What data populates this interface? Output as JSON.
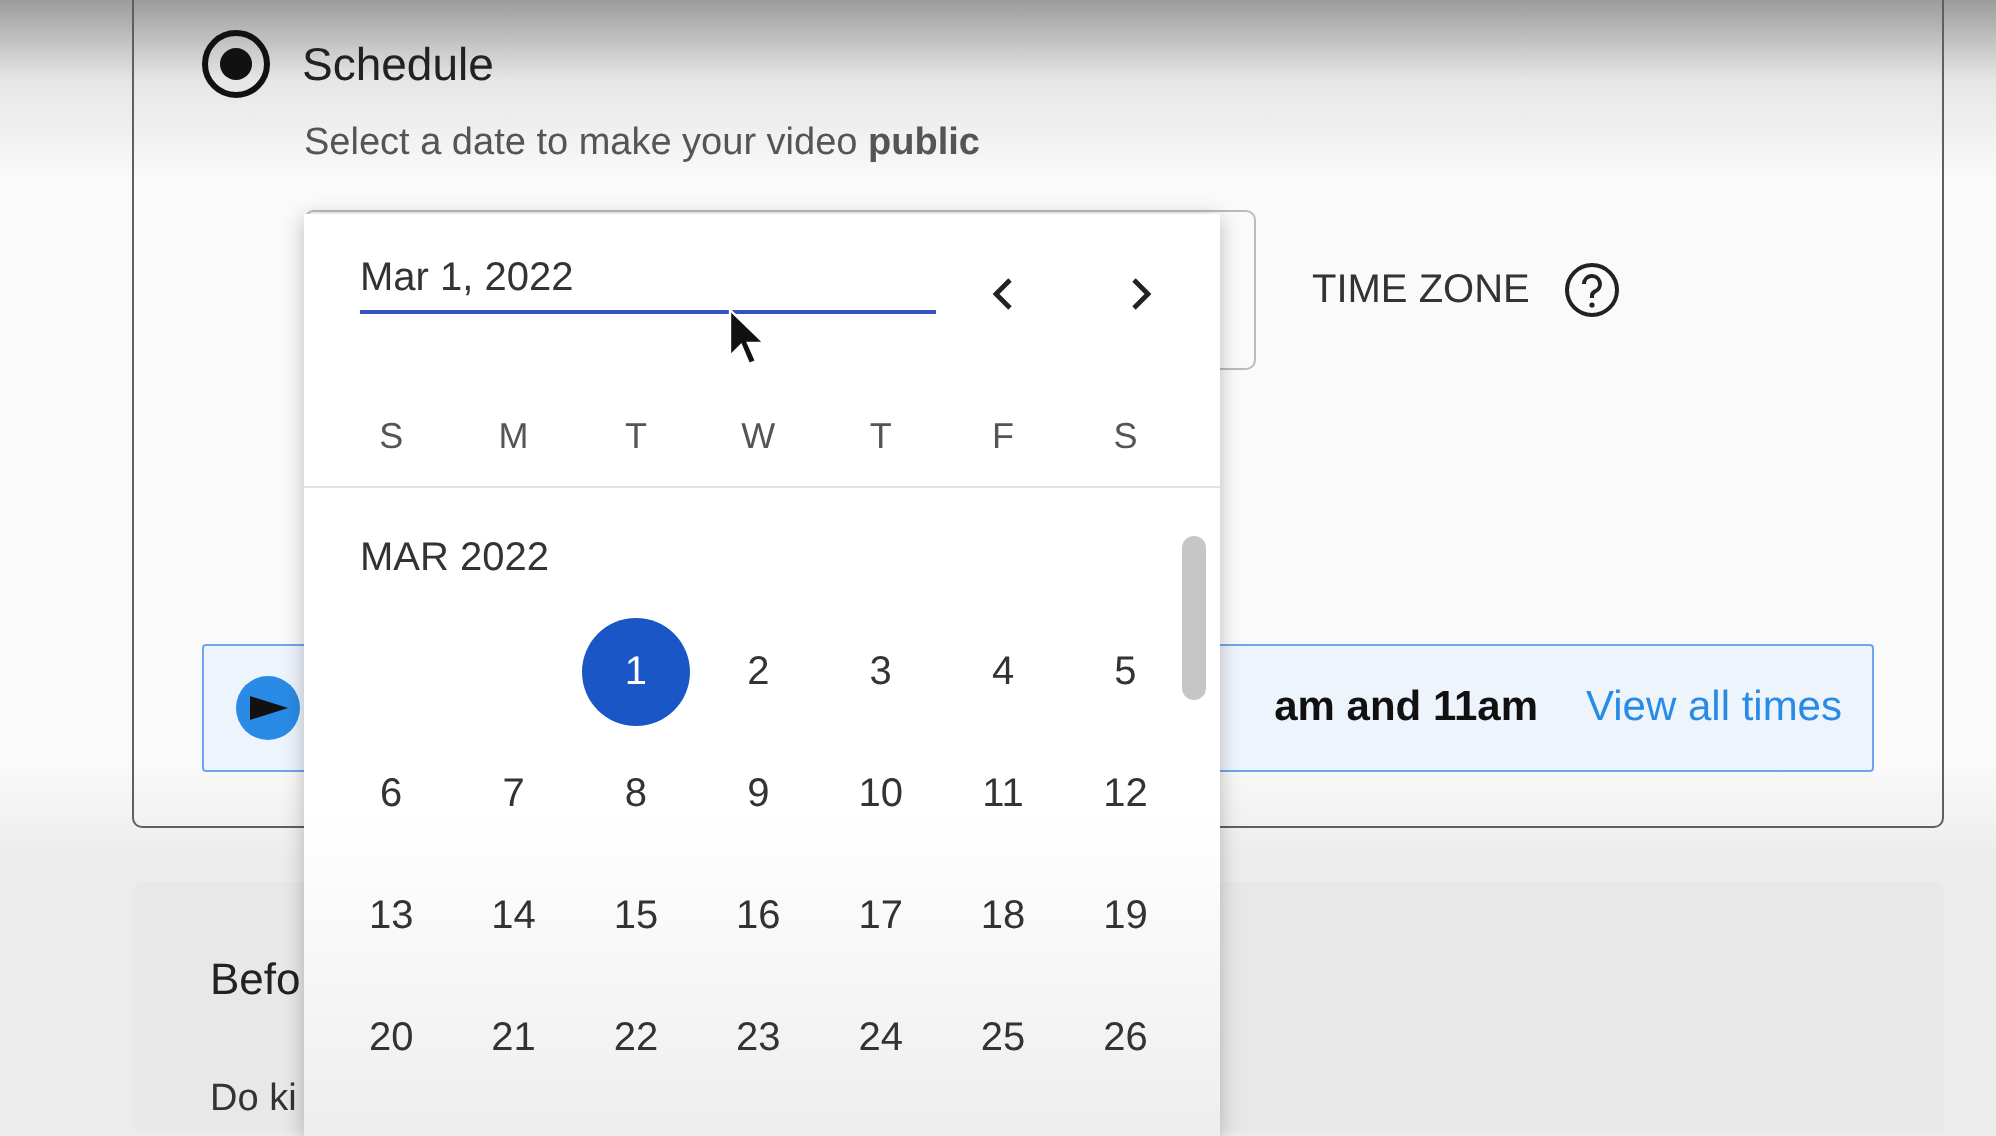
{
  "schedule": {
    "label": "Schedule",
    "selected": true,
    "description": "Select a date to make your video **public**"
  },
  "time_zone": {
    "label": "TIME ZONE"
  },
  "banner": {
    "text": "am and 11am",
    "link": "View all times"
  },
  "before_card": {
    "title": "Befo",
    "text": "Do ki"
  },
  "date_picker": {
    "value": "Mar 1, 2022",
    "weekdays": [
      "S",
      "M",
      "T",
      "W",
      "T",
      "F",
      "S"
    ],
    "month": "MAR 2022",
    "weeks": [
      [
        {
          "label": "1",
          "selected": true
        },
        {
          "label": "2",
          "selected": false
        },
        {
          "label": "3",
          "selected": false
        },
        {
          "label": "4",
          "selected": false
        },
        {
          "label": "5",
          "selected": false
        }
      ],
      [
        {
          "label": "6",
          "selected": false
        },
        {
          "label": "7",
          "selected": false
        },
        {
          "label": "8",
          "selected": false
        },
        {
          "label": "9",
          "selected": false
        },
        {
          "label": "10",
          "selected": false
        },
        {
          "label": "11",
          "selected": false
        },
        {
          "label": "12",
          "selected": false
        }
      ],
      [
        {
          "label": "13",
          "selected": false
        },
        {
          "label": "14",
          "selected": false
        },
        {
          "label": "15",
          "selected": false
        },
        {
          "label": "16",
          "selected": false
        },
        {
          "label": "17",
          "selected": false
        },
        {
          "label": "18",
          "selected": false
        },
        {
          "label": "19",
          "selected": false
        }
      ],
      [
        {
          "label": "20",
          "selected": false
        },
        {
          "label": "21",
          "selected": false
        },
        {
          "label": "22",
          "selected": false
        },
        {
          "label": "23",
          "selected": false
        },
        {
          "label": "24",
          "selected": false
        },
        {
          "label": "25",
          "selected": false
        },
        {
          "label": "26",
          "selected": false
        }
      ]
    ]
  }
}
